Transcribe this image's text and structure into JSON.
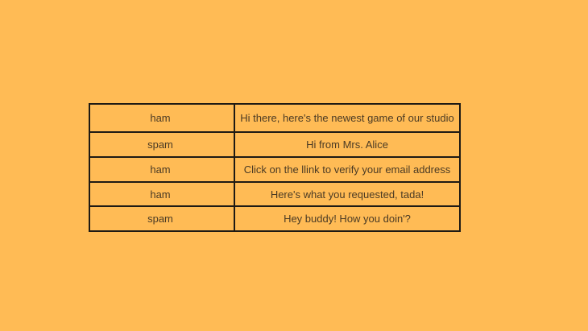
{
  "table": {
    "rows": [
      {
        "label": "ham",
        "message": "Hi there, here's the newest game of our studio"
      },
      {
        "label": "spam",
        "message": "Hi from Mrs. Alice"
      },
      {
        "label": "ham",
        "message": "Click on the llink to verify your email address"
      },
      {
        "label": "ham",
        "message": "Here's what you requested, tada!"
      },
      {
        "label": "spam",
        "message": "Hey buddy! How you doin'?"
      }
    ]
  },
  "colors": {
    "background": "#ffbb55",
    "border": "#1e1a14",
    "text": "#4a3a24"
  }
}
